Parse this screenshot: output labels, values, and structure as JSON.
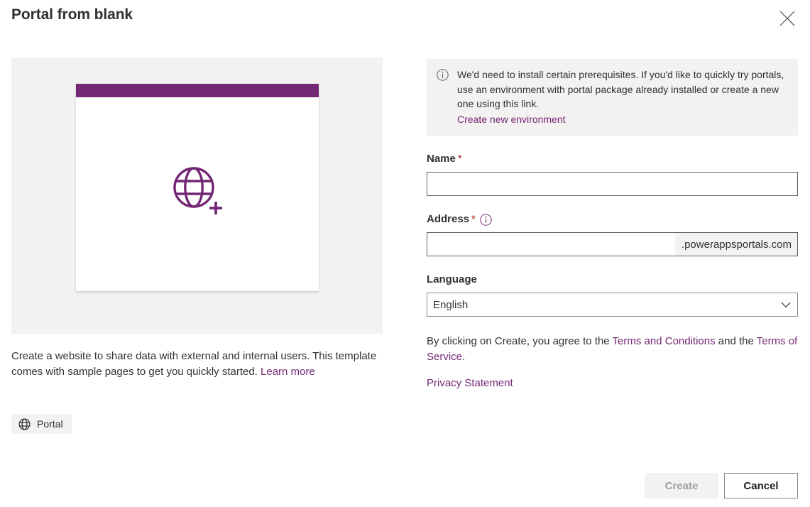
{
  "dialog": {
    "title": "Portal from blank",
    "close_icon": "close-icon"
  },
  "preview": {
    "card_bar_color": "#742774",
    "pane_background": "#f3f2f1",
    "icon": "globe-add-icon",
    "description_prefix": "Create a website to share data with external and internal users. This template comes with sample pages to get you quickly started. ",
    "learn_more_label": "Learn more",
    "tag": {
      "icon": "globe-icon",
      "label": "Portal"
    }
  },
  "info_banner": {
    "icon": "info-circle-icon",
    "message": "We'd need to install certain prerequisites. If you'd like to quickly try portals, use an environment with portal package already installed or create a new one using this link.",
    "link_label": "Create new environment"
  },
  "fields": {
    "name": {
      "label": "Name",
      "required_marker": "*",
      "value": "",
      "placeholder": ""
    },
    "address": {
      "label": "Address",
      "required_marker": "*",
      "info_icon": "info-circle-icon",
      "value": "",
      "placeholder": "",
      "suffix": ".powerappsportals.com"
    },
    "language": {
      "label": "Language",
      "selected": "English",
      "options": [
        "English"
      ],
      "chevron_icon": "chevron-down-icon"
    }
  },
  "legal": {
    "prefix": "By clicking on Create, you agree to the ",
    "terms_conditions_label": "Terms and Conditions",
    "middle": " and the ",
    "terms_of_service_label": "Terms of Service",
    "suffix": ".",
    "privacy_label": "Privacy Statement"
  },
  "footer": {
    "create_label": "Create",
    "cancel_label": "Cancel"
  },
  "colors": {
    "accent_purple": "#742774",
    "required_red": "#a4262c",
    "neutral_bg": "#f3f2f1",
    "text": "#323130"
  }
}
